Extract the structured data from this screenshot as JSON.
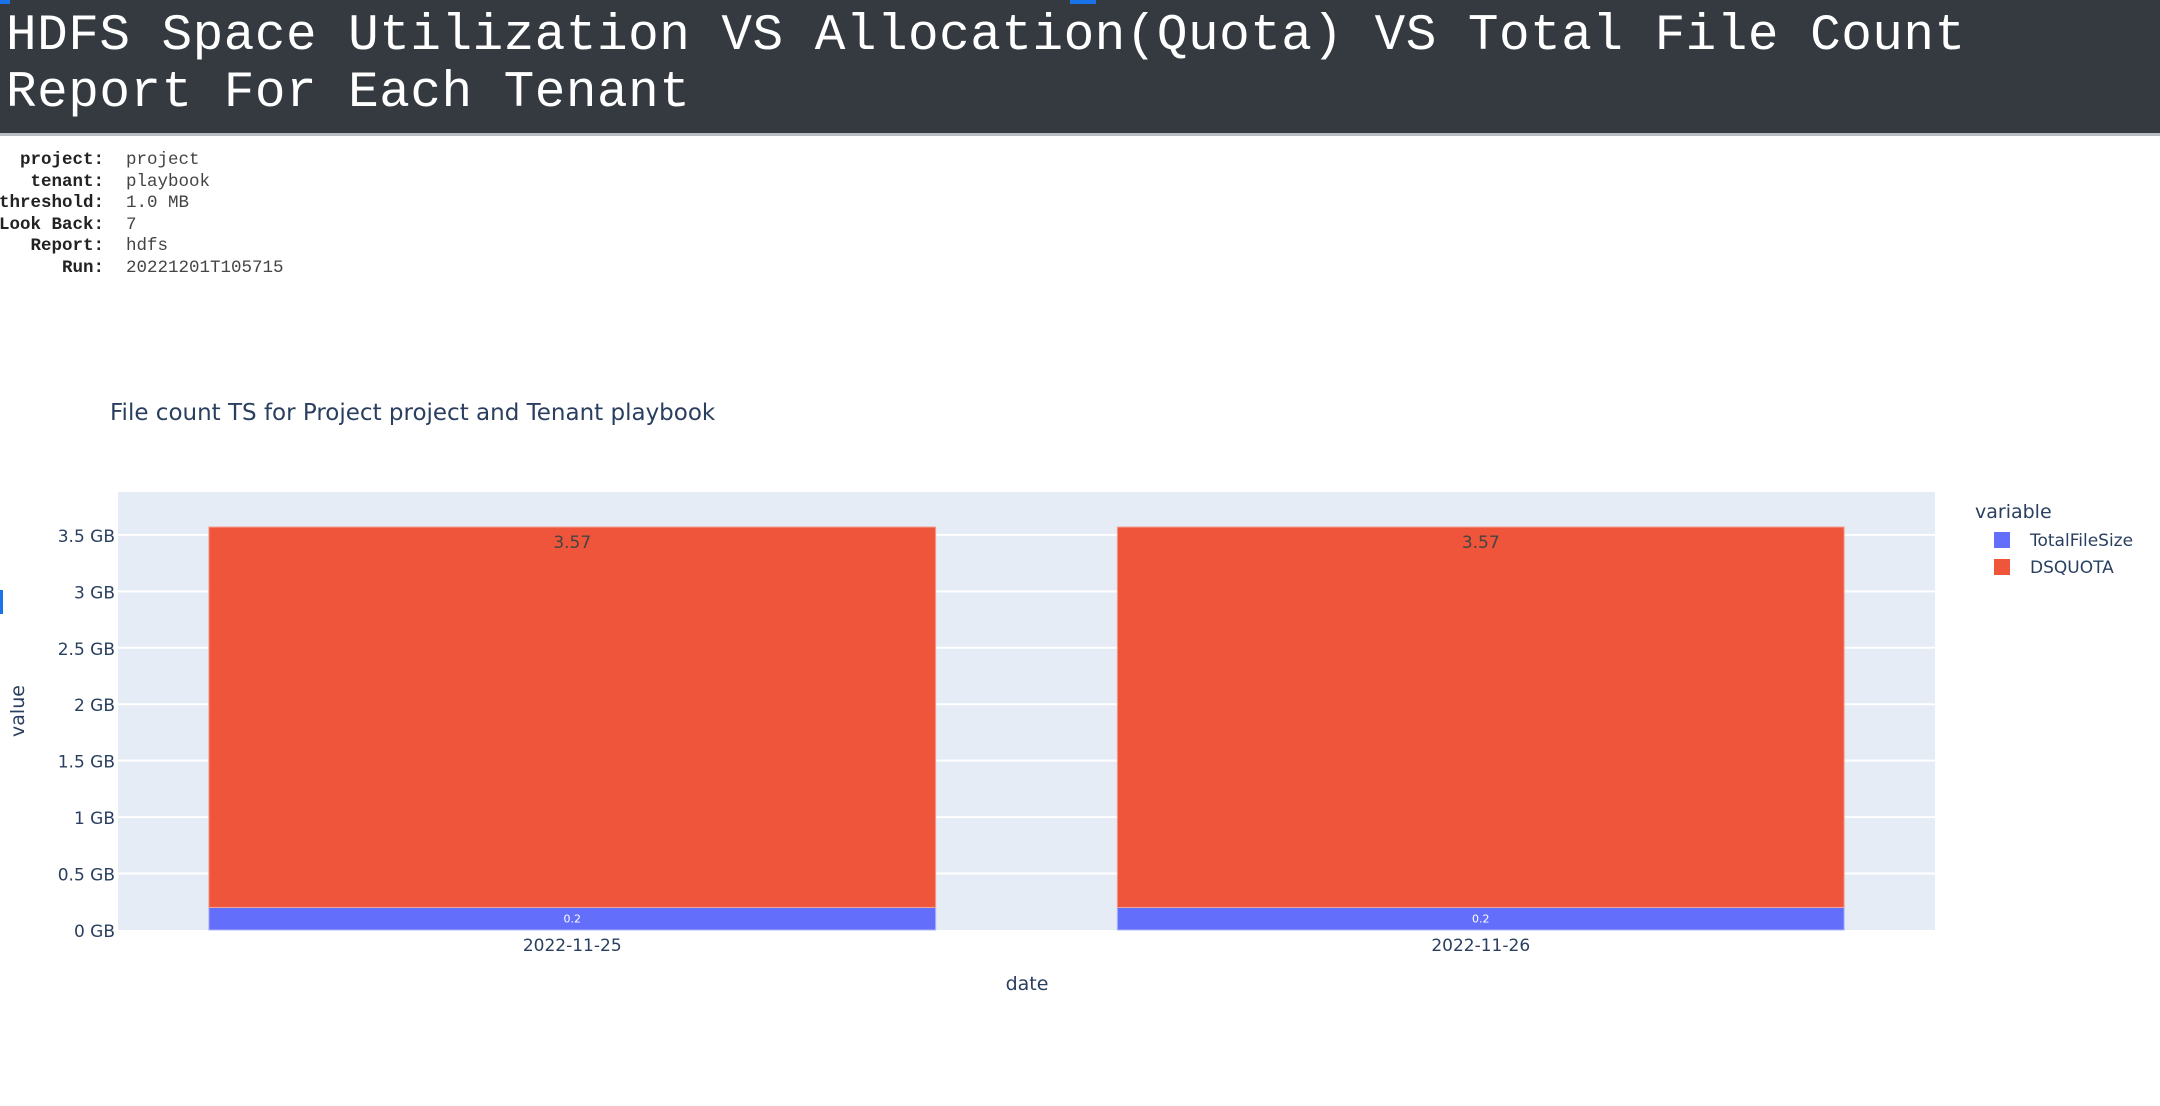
{
  "page": {
    "title": "HDFS Space Utilization VS Allocation(Quota) VS Total File Count Report For Each Tenant"
  },
  "metadata": [
    {
      "key": "project:",
      "value": "project"
    },
    {
      "key": "tenant:",
      "value": "playbook"
    },
    {
      "key": "threshold:",
      "value": "1.0 MB"
    },
    {
      "key": "Look Back:",
      "value": "7"
    },
    {
      "key": "Report:",
      "value": "hdfs"
    },
    {
      "key": "Run:",
      "value": "20221201T105715"
    }
  ],
  "colors": {
    "header_bg": "#343a40",
    "plot_bg": "#e5ecf6",
    "grid": "#ffffff",
    "text": "#2a3f5f",
    "TotalFileSize": "#636efa",
    "DSQUOTA": "#ef553b"
  },
  "chart_data": {
    "type": "bar",
    "barmode": "stack",
    "title": "File count TS for Project project and Tenant playbook",
    "xlabel": "date",
    "ylabel": "value",
    "categories": [
      "2022-11-25",
      "2022-11-26"
    ],
    "series": [
      {
        "name": "TotalFileSize",
        "values": [
          0.2,
          0.2
        ],
        "labels": [
          "0.2",
          "0.2"
        ],
        "color": "#636efa"
      },
      {
        "name": "DSQUOTA",
        "values": [
          3.37,
          3.37
        ],
        "labels": [
          "3.57",
          "3.57"
        ],
        "color": "#ef553b"
      }
    ],
    "ylim": [
      0,
      3.88
    ],
    "yticks": [
      0,
      0.5,
      1,
      1.5,
      2,
      2.5,
      3,
      3.5
    ],
    "ytick_labels": [
      "0 GB",
      "0.5 GB",
      "1 GB",
      "1.5 GB",
      "2 GB",
      "2.5 GB",
      "3 GB",
      "3.5 GB"
    ],
    "grid": true,
    "legend": {
      "title": "variable",
      "position": "top-right",
      "entries": [
        "TotalFileSize",
        "DSQUOTA"
      ]
    }
  }
}
